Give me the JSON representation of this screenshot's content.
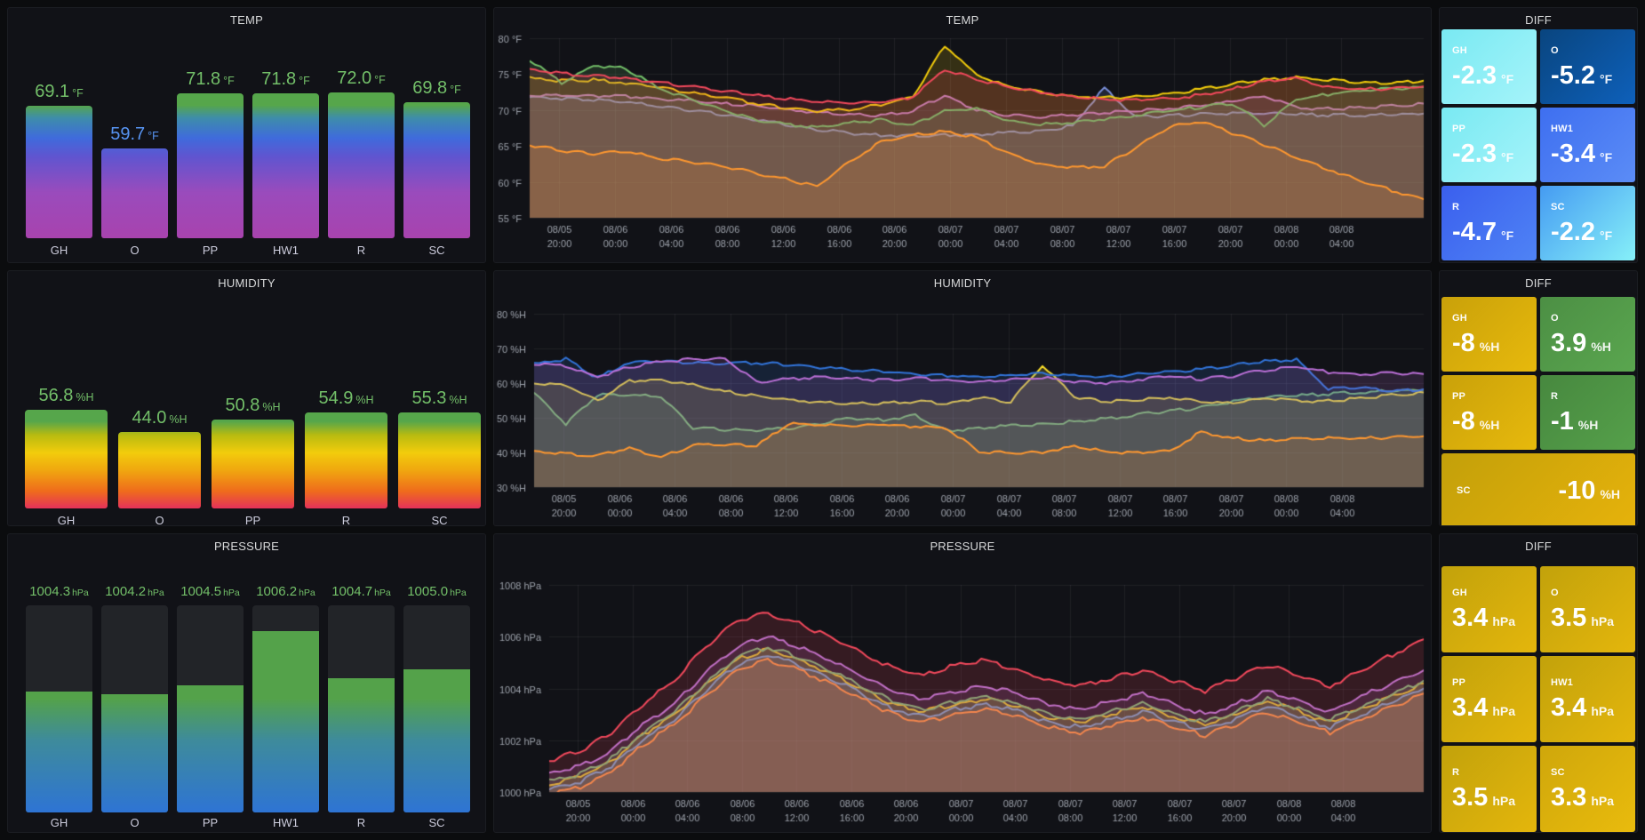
{
  "colors": {
    "bg": "#0b0c0e",
    "panel": "#111217",
    "title": "#d8d9da",
    "tick_label": "#9da2ab",
    "grid": "rgba(204,204,220,0.08)",
    "green": "#73bf69",
    "blue": "#5794f2",
    "track": "#222428"
  },
  "x_ticks": [
    [
      "08/05",
      "20:00"
    ],
    [
      "08/06",
      "00:00"
    ],
    [
      "08/06",
      "04:00"
    ],
    [
      "08/06",
      "08:00"
    ],
    [
      "08/06",
      "12:00"
    ],
    [
      "08/06",
      "16:00"
    ],
    [
      "08/06",
      "20:00"
    ],
    [
      "08/07",
      "00:00"
    ],
    [
      "08/07",
      "04:00"
    ],
    [
      "08/07",
      "08:00"
    ],
    [
      "08/07",
      "12:00"
    ],
    [
      "08/07",
      "16:00"
    ],
    [
      "08/07",
      "20:00"
    ],
    [
      "08/08",
      "00:00"
    ],
    [
      "08/08",
      "04:00"
    ]
  ],
  "temp_bars": {
    "title": "TEMP",
    "min": 40,
    "max": 80,
    "gradient": [
      [
        "0%",
        "#a843ae"
      ],
      [
        "25%",
        "#9a4bbc"
      ],
      [
        "45%",
        "#5f55d0"
      ],
      [
        "55%",
        "#3f6bdc"
      ],
      [
        "66%",
        "#3e8daa"
      ],
      [
        "73%",
        "#56a64b"
      ],
      [
        "100%",
        "#56a64b"
      ]
    ],
    "bars": [
      {
        "label": "GH",
        "value": "69.1",
        "unit": "°F",
        "num": 69.1,
        "color": "#73bf69"
      },
      {
        "label": "O",
        "value": "59.7",
        "unit": "°F",
        "num": 59.7,
        "color": "#5794f2"
      },
      {
        "label": "PP",
        "value": "71.8",
        "unit": "°F",
        "num": 71.8,
        "color": "#73bf69"
      },
      {
        "label": "HW1",
        "value": "71.8",
        "unit": "°F",
        "num": 71.8,
        "color": "#73bf69"
      },
      {
        "label": "R",
        "value": "72.0",
        "unit": "°F",
        "num": 72.0,
        "color": "#73bf69"
      },
      {
        "label": "SC",
        "value": "69.8",
        "unit": "°F",
        "num": 69.8,
        "color": "#73bf69"
      }
    ]
  },
  "humidity_bars": {
    "title": "HUMIDITY",
    "min": 0,
    "max": 100,
    "gradient": [
      [
        "0%",
        "#e5315a"
      ],
      [
        "10%",
        "#ef6c1c"
      ],
      [
        "22%",
        "#f0a70f"
      ],
      [
        "32%",
        "#f2cc0c"
      ],
      [
        "42%",
        "#b9bb10"
      ],
      [
        "50%",
        "#56a64b"
      ],
      [
        "100%",
        "#56a64b"
      ]
    ],
    "bars": [
      {
        "label": "GH",
        "value": "56.8",
        "unit": "%H",
        "num": 56.8,
        "color": "#73bf69"
      },
      {
        "label": "O",
        "value": "44.0",
        "unit": "%H",
        "num": 44.0,
        "color": "#73bf69"
      },
      {
        "label": "PP",
        "value": "50.8",
        "unit": "%H",
        "num": 50.8,
        "color": "#73bf69"
      },
      {
        "label": "R",
        "value": "54.9",
        "unit": "%H",
        "num": 54.9,
        "color": "#73bf69"
      },
      {
        "label": "SC",
        "value": "55.3",
        "unit": "%H",
        "num": 55.3,
        "color": "#73bf69"
      }
    ]
  },
  "pressure_bars": {
    "title": "PRESSURE",
    "min": 1000.5,
    "max": 1007,
    "gradient": [
      [
        "0%",
        "#2e74d4"
      ],
      [
        "35%",
        "#3e8b9b"
      ],
      [
        "55%",
        "#54a24a"
      ],
      [
        "100%",
        "#54a24a"
      ]
    ],
    "bars": [
      {
        "label": "GH",
        "value": "1004.3",
        "unit": "hPa",
        "num": 1004.3,
        "color": "#73bf69"
      },
      {
        "label": "O",
        "value": "1004.2",
        "unit": "hPa",
        "num": 1004.2,
        "color": "#73bf69"
      },
      {
        "label": "PP",
        "value": "1004.5",
        "unit": "hPa",
        "num": 1004.5,
        "color": "#73bf69"
      },
      {
        "label": "HW1",
        "value": "1006.2",
        "unit": "hPa",
        "num": 1006.2,
        "color": "#73bf69"
      },
      {
        "label": "R",
        "value": "1004.7",
        "unit": "hPa",
        "num": 1004.7,
        "color": "#73bf69"
      },
      {
        "label": "SC",
        "value": "1005.0",
        "unit": "hPa",
        "num": 1005.0,
        "color": "#73bf69"
      }
    ]
  },
  "temp_chart": {
    "title": "TEMP",
    "type": "line",
    "ymin": 55,
    "ymax": 80,
    "jitter": 0.22,
    "y_ticks": [
      {
        "v": 55,
        "t": "55 °F"
      },
      {
        "v": 60,
        "t": "60 °F"
      },
      {
        "v": 65,
        "t": "65 °F"
      },
      {
        "v": 70,
        "t": "70 °F"
      },
      {
        "v": 75,
        "t": "75 °F"
      },
      {
        "v": 80,
        "t": "80 °F"
      }
    ],
    "series": [
      {
        "color": "#7a8fd9",
        "values": [
          71.8,
          71.6,
          71.4,
          71.1,
          70.6,
          70.0,
          69.4,
          68.7,
          68.0,
          67.3,
          66.8,
          66.5,
          66.4,
          66.5,
          66.6,
          66.8,
          67.1,
          67.8,
          73.1,
          69.0,
          69.2,
          69.4,
          69.5,
          69.5,
          69.4,
          69.3,
          69.3,
          69.4,
          69.5
        ]
      },
      {
        "color": "#b877d9",
        "values": [
          72.1,
          72.0,
          72.0,
          71.9,
          71.6,
          71.3,
          70.9,
          70.6,
          70.1,
          69.7,
          69.4,
          69.3,
          69.8,
          72.1,
          70.0,
          69.2,
          69.1,
          69.3,
          69.6,
          69.9,
          70.2,
          70.6,
          71.2,
          71.9,
          70.3,
          70.2,
          70.3,
          70.6,
          70.9
        ]
      },
      {
        "color": "#f2cc0c",
        "values": [
          74.4,
          74.1,
          74.2,
          73.8,
          73.2,
          72.5,
          71.8,
          71.0,
          70.3,
          69.9,
          70.1,
          70.7,
          71.9,
          79.0,
          74.9,
          73.3,
          72.5,
          71.9,
          71.7,
          71.8,
          72.2,
          72.9,
          73.6,
          74.2,
          74.5,
          74.2,
          73.9,
          73.8,
          74.1
        ]
      },
      {
        "color": "#73bf69",
        "values": [
          77.0,
          73.8,
          76.2,
          75.8,
          73.1,
          71.6,
          70.1,
          68.7,
          68.0,
          67.6,
          68.2,
          68.6,
          67.9,
          69.9,
          70.2,
          68.4,
          68.0,
          68.3,
          68.8,
          69.3,
          69.9,
          70.4,
          70.9,
          67.9,
          71.5,
          72.2,
          72.7,
          73.0,
          73.2
        ]
      },
      {
        "color": "#f2495c",
        "values": [
          75.6,
          75.1,
          74.8,
          74.4,
          73.9,
          73.3,
          72.7,
          72.1,
          71.6,
          71.2,
          71.0,
          71.1,
          71.8,
          75.7,
          74.3,
          73.2,
          72.5,
          71.9,
          71.5,
          71.4,
          71.6,
          72.1,
          72.9,
          74.0,
          74.4,
          73.2,
          72.9,
          73.0,
          73.3
        ]
      },
      {
        "color": "#ff9830",
        "values": [
          65.1,
          64.4,
          63.9,
          64.3,
          63.3,
          62.8,
          62.2,
          61.3,
          60.4,
          59.4,
          62.8,
          65.6,
          66.5,
          67.0,
          66.2,
          64.0,
          62.4,
          62.0,
          62.2,
          64.8,
          67.6,
          68.4,
          66.8,
          65.2,
          63.4,
          61.8,
          60.2,
          58.8,
          57.6
        ]
      }
    ]
  },
  "humidity_chart": {
    "title": "HUMIDITY",
    "type": "line",
    "ymin": 30,
    "ymax": 80,
    "jitter": 0.45,
    "y_ticks": [
      {
        "v": 30,
        "t": "30 %H"
      },
      {
        "v": 40,
        "t": "40 %H"
      },
      {
        "v": 50,
        "t": "50 %H"
      },
      {
        "v": 60,
        "t": "60 %H"
      },
      {
        "v": 70,
        "t": "70 %H"
      },
      {
        "v": 80,
        "t": "80 %H"
      }
    ],
    "series": [
      {
        "color": "#73bf69",
        "values": [
          57.2,
          48.2,
          56.6,
          56.5,
          56.2,
          47.1,
          46.6,
          46.4,
          46.9,
          48.4,
          49.9,
          49.4,
          50.6,
          46.2,
          47.1,
          47.6,
          48.2,
          48.9,
          49.8,
          50.9,
          51.9,
          52.9,
          54.6,
          55.8,
          56.4,
          56.9,
          57.4,
          57.8,
          58.1
        ]
      },
      {
        "color": "#fade2a",
        "values": [
          60.1,
          59.3,
          55.0,
          60.6,
          61.0,
          59.4,
          57.6,
          56.2,
          55.2,
          54.5,
          54.1,
          54.3,
          54.6,
          54.2,
          55.8,
          54.4,
          65.3,
          56.0,
          54.6,
          55.1,
          55.9,
          54.6,
          54.2,
          55.6,
          54.8,
          54.9,
          55.6,
          56.6,
          57.3
        ]
      },
      {
        "color": "#3274d9",
        "values": [
          65.4,
          67.0,
          61.5,
          66.1,
          66.3,
          66.0,
          65.6,
          65.9,
          65.3,
          64.6,
          63.9,
          63.3,
          62.7,
          62.2,
          61.8,
          62.3,
          62.8,
          62.2,
          61.7,
          62.5,
          63.2,
          64.0,
          65.1,
          66.3,
          66.7,
          58.3,
          58.9,
          57.8,
          58.2
        ]
      },
      {
        "color": "#ba6fd6",
        "values": [
          65.6,
          65.0,
          61.8,
          64.6,
          66.2,
          66.9,
          67.1,
          60.3,
          61.1,
          61.8,
          61.3,
          60.8,
          61.5,
          60.8,
          60.3,
          60.9,
          61.6,
          60.5,
          60.1,
          61.0,
          62.1,
          61.2,
          62.0,
          63.8,
          64.8,
          63.2,
          62.4,
          63.0,
          62.6
        ]
      },
      {
        "color": "#ff9830",
        "values": [
          40.2,
          39.6,
          39.1,
          41.2,
          38.6,
          42.1,
          42.3,
          41.8,
          48.3,
          48.0,
          47.7,
          48.1,
          47.5,
          47.0,
          40.3,
          39.8,
          40.1,
          41.9,
          40.2,
          39.9,
          40.4,
          46.0,
          44.1,
          43.4,
          43.9,
          44.2,
          44.0,
          44.4,
          44.7
        ]
      }
    ]
  },
  "pressure_chart": {
    "title": "PRESSURE",
    "type": "line",
    "ymin": 1000,
    "ymax": 1008,
    "jitter": 0.09,
    "y_ticks": [
      {
        "v": 1000,
        "t": "1000 hPa"
      },
      {
        "v": 1002,
        "t": "1002 hPa"
      },
      {
        "v": 1004,
        "t": "1004 hPa"
      },
      {
        "v": 1006,
        "t": "1006 hPa"
      },
      {
        "v": 1008,
        "t": "1008 hPa"
      }
    ],
    "series": [
      {
        "color": "#5794f2",
        "values": [
          1000.1,
          1000.4,
          1001.0,
          1002.0,
          1002.8,
          1003.9,
          1004.9,
          1005.3,
          1004.9,
          1004.4,
          1003.8,
          1003.2,
          1002.9,
          1003.2,
          1003.4,
          1003.1,
          1002.7,
          1002.5,
          1002.8,
          1003.1,
          1002.7,
          1002.4,
          1002.8,
          1003.3,
          1002.9,
          1002.5,
          1003.0,
          1003.5,
          1004.0
        ]
      },
      {
        "color": "#f2cc0c",
        "values": [
          1000.3,
          1000.6,
          1001.2,
          1002.2,
          1003.0,
          1004.1,
          1005.1,
          1005.5,
          1005.1,
          1004.6,
          1004.0,
          1003.4,
          1003.1,
          1003.4,
          1003.6,
          1003.3,
          1002.9,
          1002.7,
          1003.0,
          1003.3,
          1002.9,
          1002.6,
          1003.0,
          1003.5,
          1003.1,
          1002.7,
          1003.2,
          1003.7,
          1004.2
        ]
      },
      {
        "color": "#73bf69",
        "values": [
          1000.4,
          1000.7,
          1001.3,
          1002.3,
          1003.1,
          1004.2,
          1005.2,
          1005.6,
          1005.2,
          1004.7,
          1004.1,
          1003.5,
          1003.2,
          1003.5,
          1003.7,
          1003.4,
          1003.0,
          1002.8,
          1003.1,
          1003.4,
          1003.0,
          1002.7,
          1003.1,
          1003.6,
          1003.2,
          1002.8,
          1003.3,
          1003.8,
          1004.3
        ]
      },
      {
        "color": "#ff9830",
        "values": [
          999.9,
          1000.2,
          1000.8,
          1001.8,
          1002.6,
          1003.7,
          1004.7,
          1005.1,
          1004.7,
          1004.2,
          1003.6,
          1003.0,
          1002.7,
          1003.0,
          1003.2,
          1002.9,
          1002.5,
          1002.3,
          1002.6,
          1002.9,
          1002.5,
          1002.2,
          1002.6,
          1003.1,
          1002.7,
          1002.3,
          1002.8,
          1003.3,
          1003.8
        ]
      },
      {
        "color": "#b877d9",
        "values": [
          1000.7,
          1001.0,
          1001.6,
          1002.6,
          1003.4,
          1004.6,
          1005.6,
          1006.0,
          1005.6,
          1005.1,
          1004.5,
          1003.9,
          1003.6,
          1003.9,
          1004.1,
          1003.8,
          1003.4,
          1003.2,
          1003.5,
          1003.8,
          1003.4,
          1003.0,
          1003.4,
          1003.9,
          1003.5,
          1003.1,
          1003.7,
          1004.2,
          1004.7
        ]
      },
      {
        "color": "#f2495c",
        "values": [
          1001.2,
          1001.6,
          1002.3,
          1003.4,
          1004.3,
          1005.6,
          1006.6,
          1006.9,
          1006.5,
          1006.0,
          1005.4,
          1004.8,
          1004.5,
          1004.9,
          1005.1,
          1004.7,
          1004.3,
          1004.1,
          1004.4,
          1004.7,
          1004.3,
          1003.9,
          1004.4,
          1004.9,
          1004.5,
          1004.1,
          1004.7,
          1005.3,
          1005.9
        ]
      }
    ]
  },
  "temp_diff": {
    "title": "DIFF",
    "tiles": [
      {
        "label": "GH",
        "value": "-2.3",
        "unit": "°F",
        "c1": "#79e9f2",
        "c2": "#a5f4fa"
      },
      {
        "label": "O",
        "value": "-5.2",
        "unit": "°F",
        "c1": "#09457f",
        "c2": "#0e60ba"
      },
      {
        "label": "PP",
        "value": "-2.3",
        "unit": "°F",
        "c1": "#79e9f2",
        "c2": "#a5f4fa"
      },
      {
        "label": "HW1",
        "value": "-3.4",
        "unit": "°F",
        "c1": "#3e6ff0",
        "c2": "#5b8cf6"
      },
      {
        "label": "R",
        "value": "-4.7",
        "unit": "°F",
        "c1": "#3a5fee",
        "c2": "#4f83f5"
      },
      {
        "label": "SC",
        "value": "-2.2",
        "unit": "°F",
        "c1": "#459bf2",
        "c2": "#86f0f8"
      }
    ]
  },
  "humidity_diff": {
    "title": "DIFF",
    "tiles": [
      {
        "label": "GH",
        "value": "-8",
        "unit": "%H",
        "c1": "#c9a10a",
        "c2": "#e7b90c"
      },
      {
        "label": "O",
        "value": "3.9",
        "unit": "%H",
        "c1": "#4c8f44",
        "c2": "#5aa64f"
      },
      {
        "label": "PP",
        "value": "-8",
        "unit": "%H",
        "c1": "#c9a10a",
        "c2": "#e7b90c"
      },
      {
        "label": "R",
        "value": "-1",
        "unit": "%H",
        "c1": "#47883f",
        "c2": "#55a04a"
      },
      {
        "label": "SC",
        "value": "-10",
        "unit": "%H",
        "wide": true,
        "c1": "#c3a00a",
        "c2": "#e6b20b"
      }
    ]
  },
  "pressure_diff": {
    "title": "DIFF",
    "tiles": [
      {
        "label": "GH",
        "value": "3.4",
        "unit": "hPa",
        "c1": "#c2a20b",
        "c2": "#e4b60c"
      },
      {
        "label": "O",
        "value": "3.5",
        "unit": "hPa",
        "c1": "#c2a20b",
        "c2": "#e4b60c"
      },
      {
        "label": "PP",
        "value": "3.4",
        "unit": "hPa",
        "c1": "#c2a20b",
        "c2": "#e4b60c"
      },
      {
        "label": "HW1",
        "value": "3.4",
        "unit": "hPa",
        "c1": "#c2a20b",
        "c2": "#e4b60c"
      },
      {
        "label": "R",
        "value": "3.5",
        "unit": "hPa",
        "c1": "#c2a20b",
        "c2": "#e4b60c"
      },
      {
        "label": "SC",
        "value": "3.3",
        "unit": "hPa",
        "c1": "#cfa70b",
        "c2": "#e9bb0d"
      }
    ]
  }
}
